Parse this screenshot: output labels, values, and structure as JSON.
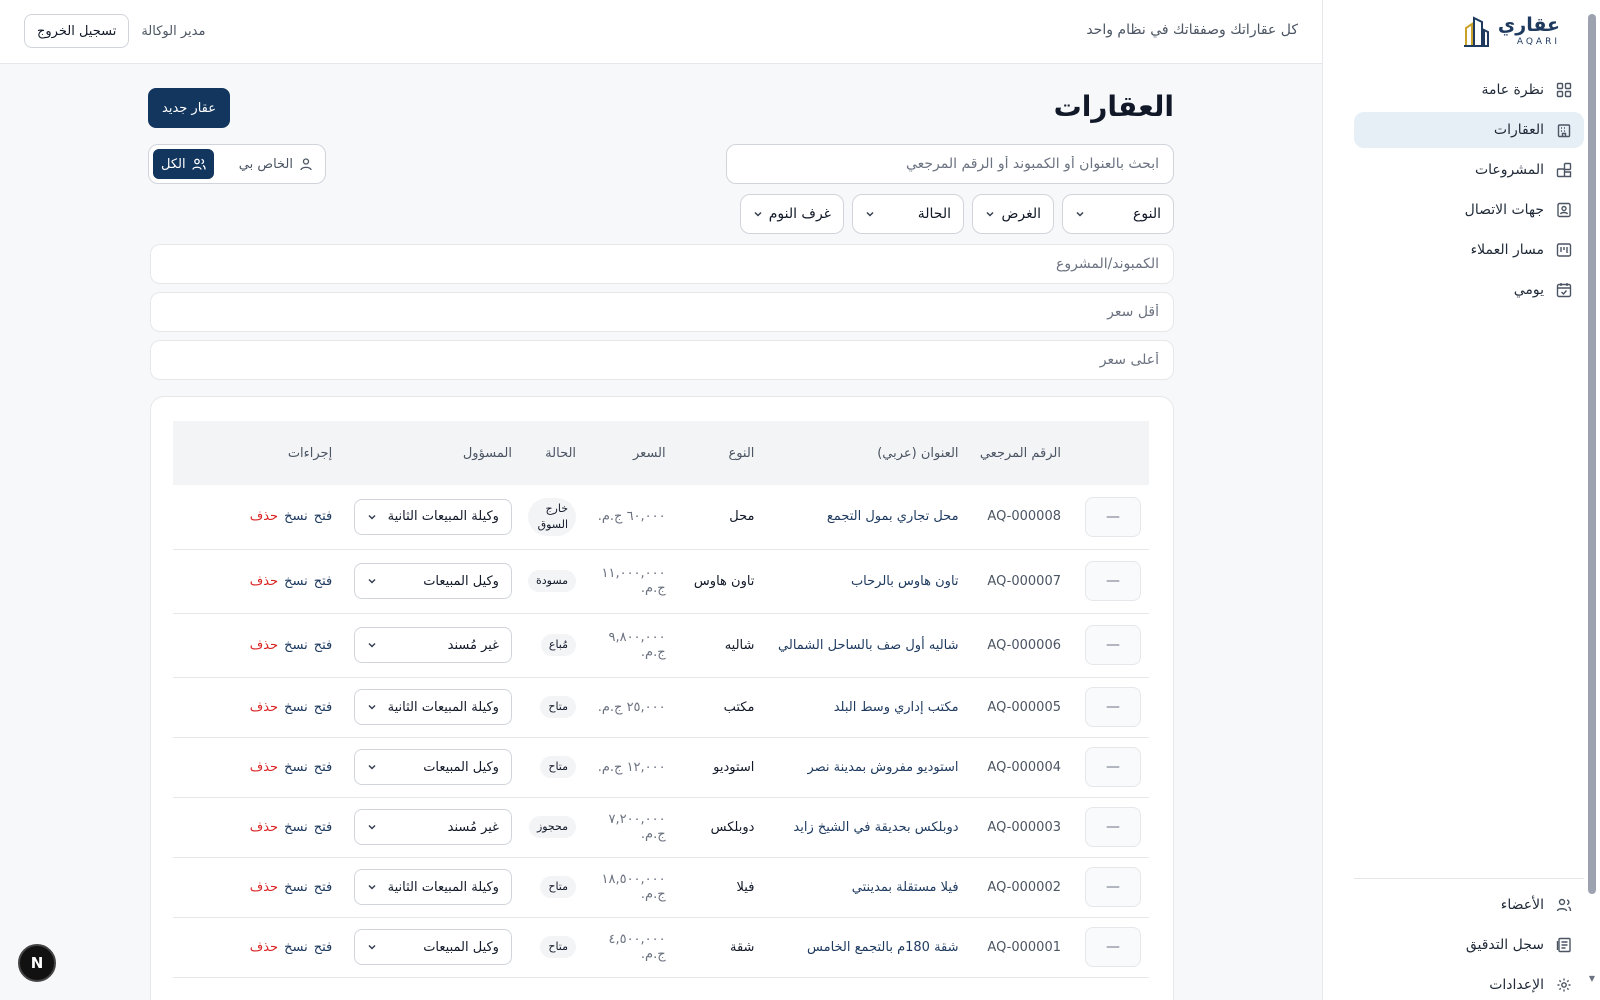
{
  "brand": {
    "name_ar": "عقاري",
    "name_en": "AQARI"
  },
  "header": {
    "tagline": "كل عقاراتك وصفقاتك في نظام واحد",
    "role": "مدير الوكالة",
    "logout": "تسجيل الخروج"
  },
  "sidebar": {
    "items": [
      {
        "label": "نظرة عامة",
        "icon": "dashboard-grid-icon"
      },
      {
        "label": "العقارات",
        "icon": "building-icon"
      },
      {
        "label": "المشروعات",
        "icon": "layers-icon"
      },
      {
        "label": "جهات الاتصال",
        "icon": "contacts-icon"
      },
      {
        "label": "مسار العملاء",
        "icon": "pipeline-icon"
      },
      {
        "label": "يومي",
        "icon": "calendar-icon"
      }
    ],
    "bottom": [
      {
        "label": "الأعضاء",
        "icon": "users-icon"
      },
      {
        "label": "سجل التدقيق",
        "icon": "audit-log-icon"
      },
      {
        "label": "الإعدادات",
        "icon": "gear-icon"
      }
    ],
    "active_index": 1
  },
  "page": {
    "title": "العقارات",
    "new_button": "عقار جديد",
    "search_placeholder": "ابحث بالعنوان أو الكمبوند أو الرقم المرجعي",
    "scope": {
      "mine": "الخاص بي",
      "all": "الكل",
      "active": "all"
    },
    "filters": {
      "type": "النوع",
      "purpose": "الغرض",
      "status": "الحالة",
      "bedrooms": "غرف النوم"
    },
    "compound_placeholder": "الكمبوند/المشروع",
    "min_price_placeholder": "أقل سعر",
    "max_price_placeholder": "أعلى سعر"
  },
  "table": {
    "headers": {
      "ref": "الرقم المرجعي",
      "title": "العنوان (عربي)",
      "type": "النوع",
      "price": "السعر",
      "status": "الحالة",
      "owner": "المسؤول",
      "actions": "إجراءات"
    },
    "action_labels": {
      "open": "فتح",
      "copy": "نسخ",
      "delete": "حذف"
    },
    "dash": "—",
    "rows": [
      {
        "ref": "AQ-000008",
        "title": "محل تجاري بمول التجمع",
        "type": "محل",
        "price": "٦٠,٠٠٠ ج.م.",
        "status": "خارج السوق",
        "owner": "وكيلة المبيعات الثانية"
      },
      {
        "ref": "AQ-000007",
        "title": "تاون هاوس بالرحاب",
        "type": "تاون هاوس",
        "price": "١١,٠٠٠,٠٠٠ ج.م.",
        "status": "مسودة",
        "owner": "وكيل المبيعات"
      },
      {
        "ref": "AQ-000006",
        "title": "شاليه أول صف بالساحل الشمالي",
        "type": "شاليه",
        "price": "٩,٨٠٠,٠٠٠ ج.م.",
        "status": "مُباع",
        "owner": "غير مُسند"
      },
      {
        "ref": "AQ-000005",
        "title": "مكتب إداري وسط البلد",
        "type": "مكتب",
        "price": "٢٥,٠٠٠ ج.م.",
        "status": "متاح",
        "owner": "وكيلة المبيعات الثانية"
      },
      {
        "ref": "AQ-000004",
        "title": "استوديو مفروش بمدينة نصر",
        "type": "استوديو",
        "price": "١٢,٠٠٠ ج.م.",
        "status": "متاح",
        "owner": "وكيل المبيعات"
      },
      {
        "ref": "AQ-000003",
        "title": "دوبلكس بحديقة في الشيخ زايد",
        "type": "دوبلكس",
        "price": "٧,٢٠٠,٠٠٠ ج.م.",
        "status": "محجوز",
        "owner": "غير مُسند"
      },
      {
        "ref": "AQ-000002",
        "title": "فيلا مستقلة بمدينتي",
        "type": "فيلا",
        "price": "١٨,٥٠٠,٠٠٠ ج.م.",
        "status": "متاح",
        "owner": "وكيلة المبيعات الثانية"
      },
      {
        "ref": "AQ-000001",
        "title": "شقة 180م بالتجمع الخامس",
        "type": "شقة",
        "price": "٤,٥٠٠,٠٠٠ ج.م.",
        "status": "متاح",
        "owner": "وكيل المبيعات"
      }
    ]
  },
  "dev_badge": "N",
  "colors": {
    "primary": "#12365e",
    "active_nav": "#e6eef6",
    "danger": "#dc2626"
  }
}
